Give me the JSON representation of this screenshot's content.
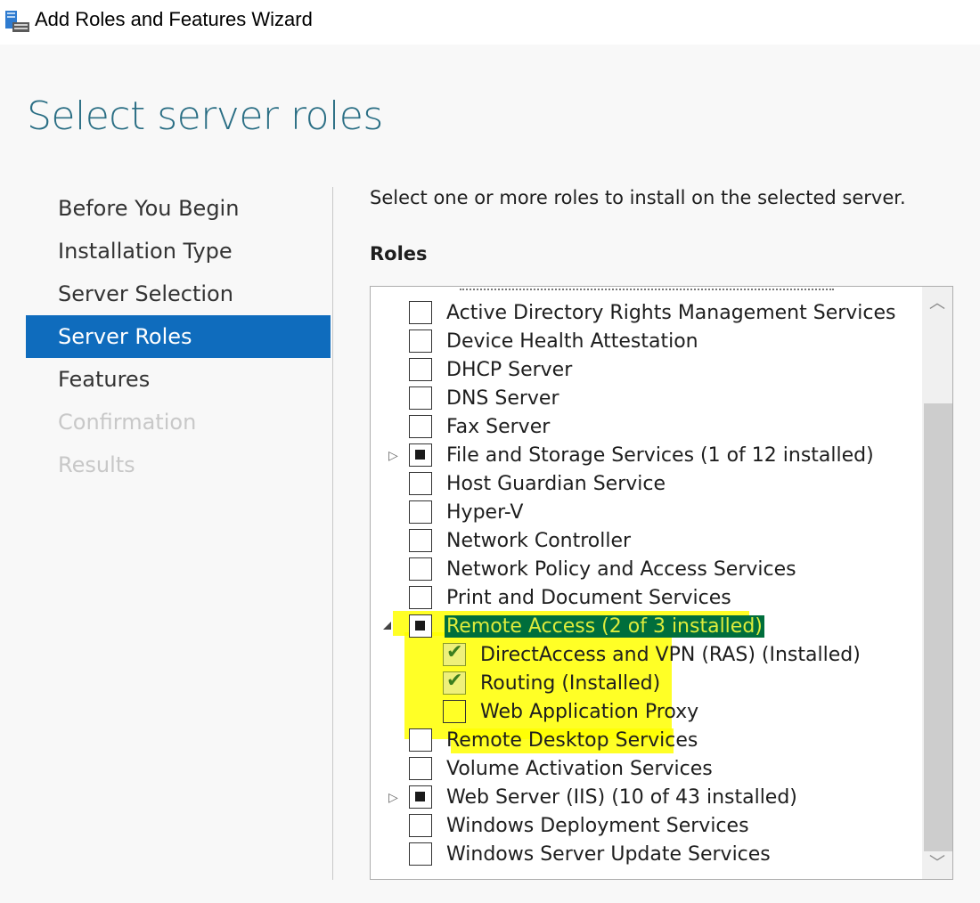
{
  "window": {
    "title": "Add Roles and Features Wizard",
    "icon": "server-manager-icon"
  },
  "page": {
    "title": "Select server roles",
    "instruction": "Select one or more roles to install on the selected server.",
    "roles_heading": "Roles"
  },
  "nav": {
    "items": [
      {
        "label": "Before You Begin",
        "state": "normal"
      },
      {
        "label": "Installation Type",
        "state": "normal"
      },
      {
        "label": "Server Selection",
        "state": "normal"
      },
      {
        "label": "Server Roles",
        "state": "selected"
      },
      {
        "label": "Features",
        "state": "normal"
      },
      {
        "label": "Confirmation",
        "state": "disabled"
      },
      {
        "label": "Results",
        "state": "disabled"
      }
    ]
  },
  "roles": [
    {
      "label": "Active Directory Rights Management Services",
      "state": "unchecked",
      "level": 0
    },
    {
      "label": "Device Health Attestation",
      "state": "unchecked",
      "level": 0
    },
    {
      "label": "DHCP Server",
      "state": "unchecked",
      "level": 0
    },
    {
      "label": "DNS Server",
      "state": "unchecked",
      "level": 0
    },
    {
      "label": "Fax Server",
      "state": "unchecked",
      "level": 0
    },
    {
      "label": "File and Storage Services (1 of 12 installed)",
      "state": "indeterminate",
      "level": 0,
      "expander": "collapsed"
    },
    {
      "label": "Host Guardian Service",
      "state": "unchecked",
      "level": 0
    },
    {
      "label": "Hyper-V",
      "state": "unchecked",
      "level": 0
    },
    {
      "label": "Network Controller",
      "state": "unchecked",
      "level": 0
    },
    {
      "label": "Network Policy and Access Services",
      "state": "unchecked",
      "level": 0
    },
    {
      "label": "Print and Document Services",
      "state": "unchecked",
      "level": 0
    },
    {
      "label": "Remote Access (2 of 3 installed)",
      "state": "indeterminate",
      "level": 0,
      "expander": "expanded",
      "selected": true
    },
    {
      "label": "DirectAccess and VPN (RAS) (Installed)",
      "state": "checked-disabled",
      "level": 1
    },
    {
      "label": "Routing (Installed)",
      "state": "checked-disabled",
      "level": 1
    },
    {
      "label": "Web Application Proxy",
      "state": "unchecked",
      "level": 1
    },
    {
      "label": "Remote Desktop Services",
      "state": "unchecked",
      "level": 0
    },
    {
      "label": "Volume Activation Services",
      "state": "unchecked",
      "level": 0
    },
    {
      "label": "Web Server (IIS) (10 of 43 installed)",
      "state": "indeterminate",
      "level": 0,
      "expander": "collapsed"
    },
    {
      "label": "Windows Deployment Services",
      "state": "unchecked",
      "level": 0
    },
    {
      "label": "Windows Server Update Services",
      "state": "unchecked",
      "level": 0
    }
  ],
  "scrollbar": {
    "up_icon": "chevron-up-icon",
    "down_icon": "chevron-down-icon"
  },
  "highlight_color": "#ffff00"
}
